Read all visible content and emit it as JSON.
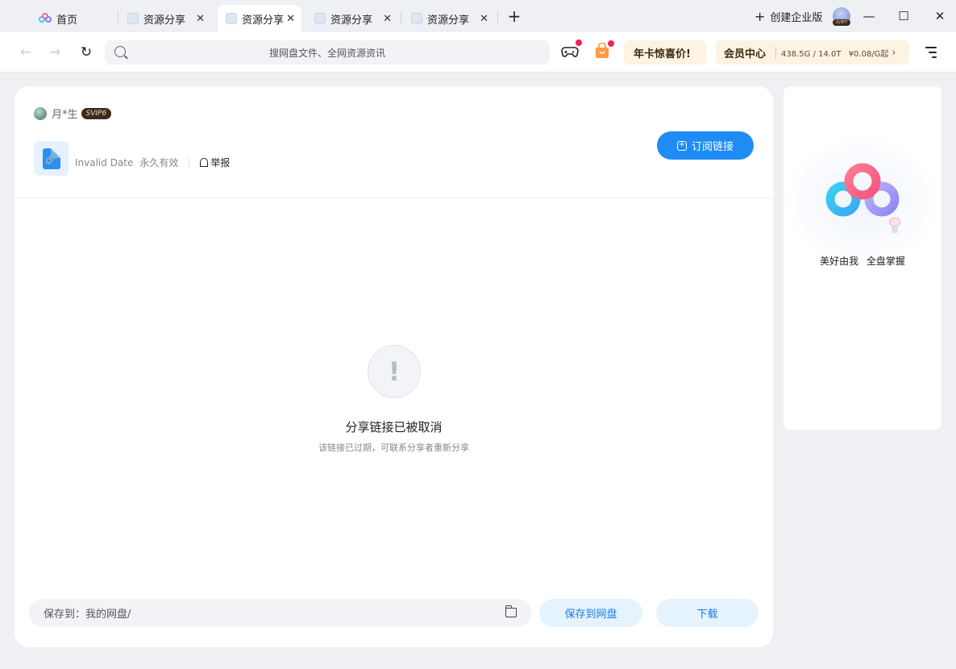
{
  "titlebar": {
    "tabs": [
      {
        "label": "首页",
        "closable": false
      },
      {
        "label": "资源分享",
        "closable": true
      },
      {
        "label": "资源分享",
        "closable": true,
        "active": true
      },
      {
        "label": "资源分享",
        "closable": true
      },
      {
        "label": "资源分享",
        "closable": true
      }
    ],
    "new_tab": "+",
    "create_enterprise": "创建企业版",
    "avatar_badge": "SVIP7",
    "window_minimize": "—",
    "window_maximize": "☐",
    "window_close": "✕"
  },
  "toolbar": {
    "search_placeholder": "搜网盘文件、全网资源资讯",
    "promo_label": "年卡惊喜价!",
    "vip_title": "会员中心",
    "vip_storage": "438.5G / 14.0T",
    "vip_price": "¥0.08/G起",
    "icons": [
      "back-arrow-icon",
      "forward-arrow-icon",
      "refresh-icon",
      "search-icon",
      "gamepad-icon",
      "gift-bag-icon",
      "menu-icon"
    ]
  },
  "share": {
    "owner_name": "月*生",
    "owner_badge": "SVIP6",
    "date": "Invalid Date",
    "validity": "永久有效",
    "report_label": "举报",
    "subscribe_label": "订阅链接",
    "error_icon": "!",
    "error_title": "分享链接已被取消",
    "error_subtitle": "该链接已过期，可联系分享者重新分享",
    "save_path": "保存到：我的网盘/",
    "save_button": "保存到网盘",
    "download_button": "下载"
  },
  "side": {
    "tagline": "美好由我 全盘掌握"
  },
  "colors": {
    "accent": "#1e8cf4",
    "reddot": "#f5224d",
    "promo_bg": "#fdf3e3"
  }
}
